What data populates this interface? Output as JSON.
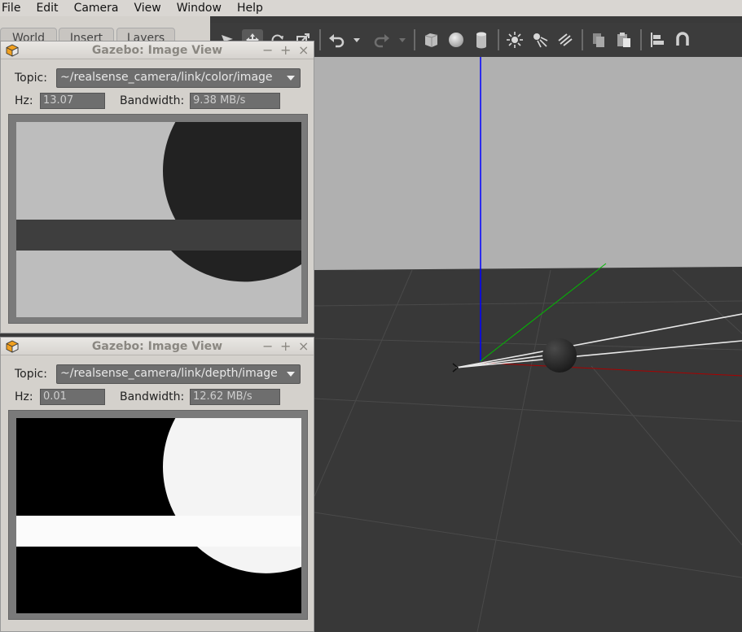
{
  "menubar": {
    "items": [
      "File",
      "Edit",
      "Camera",
      "View",
      "Window",
      "Help"
    ]
  },
  "left_tabs": [
    "World",
    "Insert",
    "Layers"
  ],
  "toolbar": {
    "icons": [
      "select-mode-icon",
      "translate-mode-icon",
      "rotate-mode-icon",
      "scale-mode-icon",
      "undo-icon",
      "undo-history-icon",
      "redo-icon",
      "redo-history-icon",
      "box-shape-icon",
      "sphere-shape-icon",
      "cylinder-shape-icon",
      "point-light-icon",
      "spot-light-icon",
      "directional-light-icon",
      "copy-icon",
      "paste-icon",
      "align-icon",
      "snap-icon"
    ]
  },
  "color_view": {
    "title": "Gazebo: Image View",
    "topic_label": "Topic:",
    "topic_value": "~/realsense_camera/link/color/image",
    "hz_label": "Hz:",
    "hz_value": "13.07",
    "bandwidth_label": "Bandwidth:",
    "bandwidth_value": "9.38 MB/s"
  },
  "depth_view": {
    "title": "Gazebo: Image View",
    "topic_label": "Topic:",
    "topic_value": "~/realsense_camera/link/depth/image",
    "hz_label": "Hz:",
    "hz_value": "0.01",
    "bandwidth_label": "Bandwidth:",
    "bandwidth_value": "12.62 MB/s"
  },
  "window_controls": {
    "minimize": "−",
    "maximize": "+",
    "close": "×"
  },
  "colors": {
    "sky": "#b0b0b0",
    "ground": "#383838",
    "z_axis": "#0000ff",
    "y_axis": "#00cc00",
    "x_axis": "#cc0000"
  }
}
